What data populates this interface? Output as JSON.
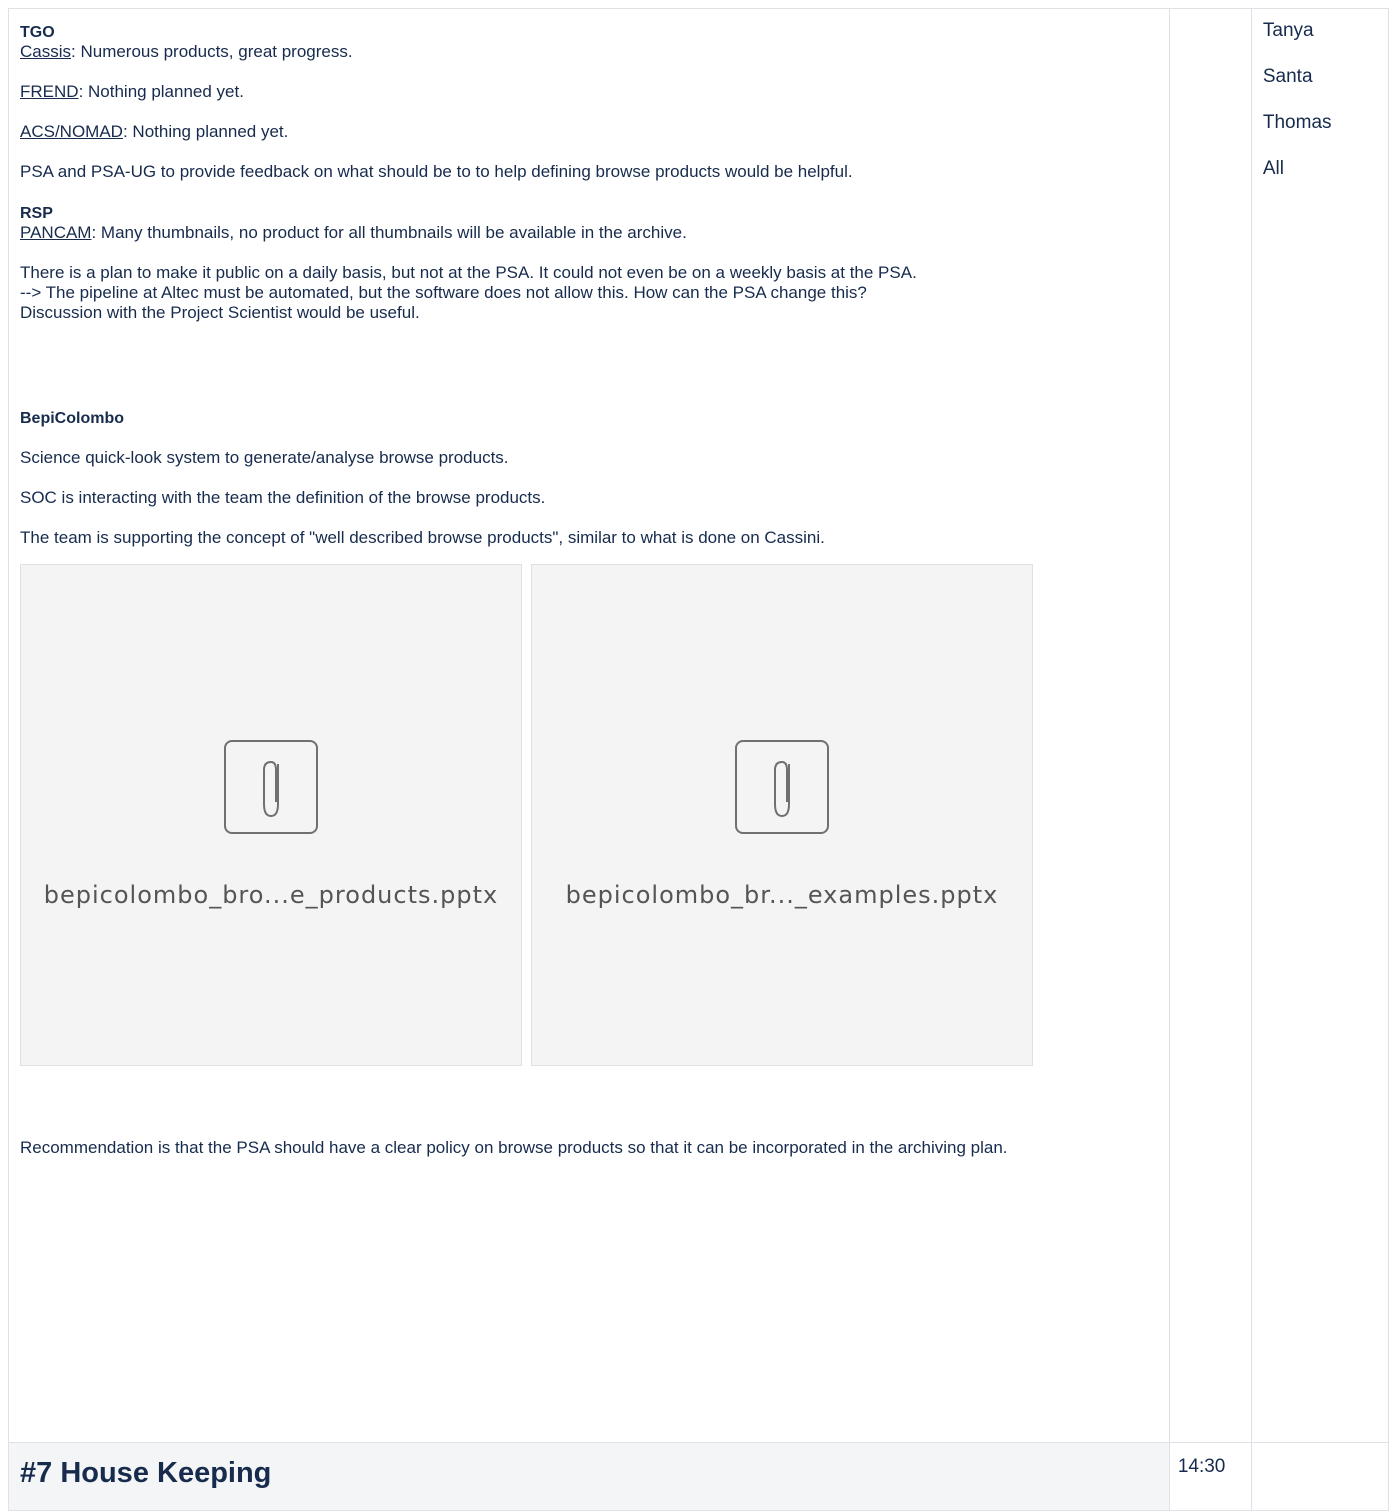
{
  "tgo": {
    "title": "TGO",
    "items": [
      {
        "link": "Cassis",
        "text": ": Numerous products, great progress."
      },
      {
        "link": "FREND",
        "text": ": Nothing planned yet."
      },
      {
        "link": "ACS/NOMAD",
        "text": ": Nothing planned yet."
      }
    ],
    "note": "PSA and PSA-UG to provide feedback on what should be to to help defining browse products would be helpful."
  },
  "rsp": {
    "title": "RSP",
    "pancam_link": "PANCAM",
    "pancam_text": ": Many thumbnails, no product for all thumbnails will be available in the archive.",
    "plan_line1": "There is a plan to make it public on a daily basis, but not at the PSA. It could not even be on a weekly basis at the PSA.",
    "plan_line2": "--> The pipeline at Altec must be automated, but the software does not allow this. How can the PSA change this?",
    "plan_line3": "Discussion with the Project Scientist would be useful."
  },
  "bepi": {
    "title": "BepiColombo",
    "p1": "Science quick-look system to generate/analyse browse products.",
    "p2": "SOC is interacting with the team the definition of the browse products.",
    "p3": "The team is supporting the concept of \"well described browse products\", similar to what is done on Cassini.",
    "attachments": [
      {
        "name": "bepicolombo_bro...e_products.pptx",
        "icon": "paperclip-icon"
      },
      {
        "name": "bepicolombo_br..._examples.pptx",
        "icon": "paperclip-icon"
      }
    ],
    "recommendation": "Recommendation is that the PSA should have a clear policy on browse products so that it can be incorporated in the archiving plan."
  },
  "who": [
    "Tanya",
    "Santa",
    "Thomas",
    "All"
  ],
  "next_item": {
    "title": "#7 House Keeping",
    "time": "14:30"
  },
  "colors": {
    "text": "#172b4d",
    "border": "#dfe1e6",
    "heading_bg": "#f4f5f7",
    "attachment_bg": "#f4f4f4"
  }
}
